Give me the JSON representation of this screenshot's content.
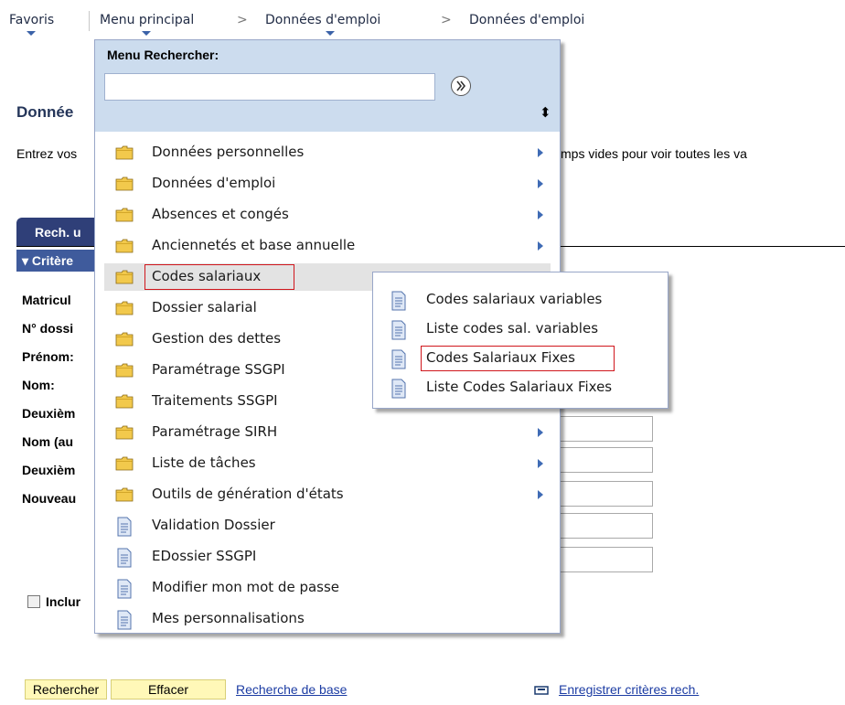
{
  "nav": {
    "favoris": "Favoris",
    "menu_principal": "Menu principal",
    "sep": ">",
    "crumb1": "Données d'emploi",
    "crumb2": "Données d'emploi"
  },
  "page": {
    "title": "Donnée",
    "instruction_left": "Entrez vos",
    "instruction_right": "mps vides pour voir toutes les va",
    "tab_label": "Rech. u",
    "criteria_label": "Critère",
    "fields": [
      "Matricul",
      "N° dossi",
      "Prénom:",
      "Nom:",
      "Deuxièm",
      "Nom (au",
      "Deuxièm",
      "Nouveau"
    ],
    "include_label": "Inclur"
  },
  "buttons": {
    "search": "Rechercher",
    "clear": "Effacer",
    "basic_search": "Recherche de base",
    "save_criteria": "Enregistrer critères rech."
  },
  "menu": {
    "search_label": "Menu Rechercher:",
    "search_value": "",
    "sort_glyph": "⬍",
    "items": [
      {
        "label": "Données personnelles",
        "type": "folder",
        "submenu": true
      },
      {
        "label": "Données d'emploi",
        "type": "folder",
        "submenu": true
      },
      {
        "label": "Absences et congés",
        "type": "folder",
        "submenu": true
      },
      {
        "label": "Anciennetés et base annuelle",
        "type": "folder",
        "submenu": true
      },
      {
        "label": "Codes salariaux",
        "type": "folder",
        "submenu": true,
        "highlighted": true
      },
      {
        "label": "Dossier salarial",
        "type": "folder",
        "submenu": true
      },
      {
        "label": "Gestion des dettes",
        "type": "folder",
        "submenu": true
      },
      {
        "label": "Paramétrage SSGPI",
        "type": "folder",
        "submenu": true
      },
      {
        "label": "Traitements SSGPI",
        "type": "folder",
        "submenu": true
      },
      {
        "label": "Paramétrage SIRH",
        "type": "folder",
        "submenu": true
      },
      {
        "label": "Liste de tâches",
        "type": "folder",
        "submenu": true
      },
      {
        "label": "Outils de génération d'états",
        "type": "folder",
        "submenu": true
      },
      {
        "label": "Validation Dossier",
        "type": "page",
        "submenu": false
      },
      {
        "label": "EDossier SSGPI",
        "type": "page",
        "submenu": false
      },
      {
        "label": "Modifier mon mot de passe",
        "type": "page",
        "submenu": false
      },
      {
        "label": "Mes personnalisations",
        "type": "page",
        "submenu": false
      }
    ]
  },
  "submenu": {
    "items": [
      {
        "label": "Codes salariaux variables"
      },
      {
        "label": "Liste codes sal. variables"
      },
      {
        "label": "Codes Salariaux Fixes",
        "highlighted": true
      },
      {
        "label": "Liste Codes Salariaux Fixes"
      }
    ]
  },
  "colors": {
    "accent": "#2f3f78",
    "menu_header": "#ccdcee",
    "highlight_box": "#d0161c",
    "folder": "#f2c94c",
    "link": "#1c3ca3",
    "button_bg": "#fff8b8"
  }
}
